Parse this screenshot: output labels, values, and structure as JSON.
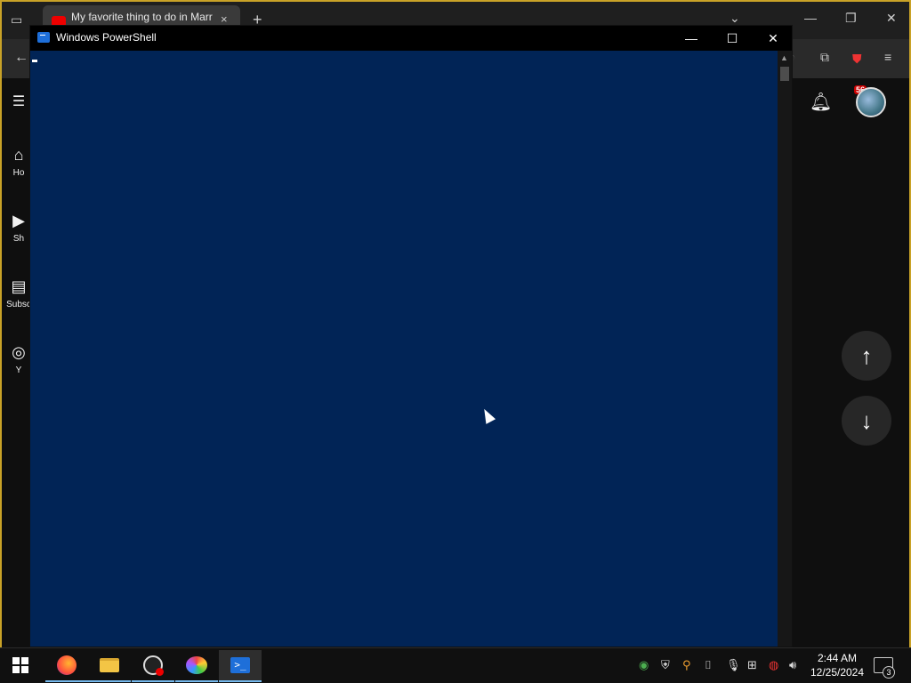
{
  "browser": {
    "tab_title": "My favorite thing to do in Marr",
    "new_tab_label": "+",
    "extensions_badge": "56",
    "sidebar": [
      {
        "label": "Ho",
        "icon": "home-icon"
      },
      {
        "label": "Sh",
        "icon": "shorts-icon"
      },
      {
        "label": "Subsc",
        "icon": "subscriptions-icon"
      },
      {
        "label": "Y",
        "icon": "you-icon"
      }
    ]
  },
  "powershell": {
    "title": "Windows PowerShell",
    "background_color": "#012456"
  },
  "taskbar": {
    "apps": [
      {
        "name": "firefox",
        "icon": "firefox-icon"
      },
      {
        "name": "file-explorer",
        "icon": "folder-icon"
      },
      {
        "name": "obs",
        "icon": "obs-icon"
      },
      {
        "name": "paint",
        "icon": "palette-icon"
      },
      {
        "name": "powershell",
        "icon": "powershell-icon"
      }
    ],
    "time": "2:44 AM",
    "date": "12/25/2024",
    "notification_count": "3"
  }
}
